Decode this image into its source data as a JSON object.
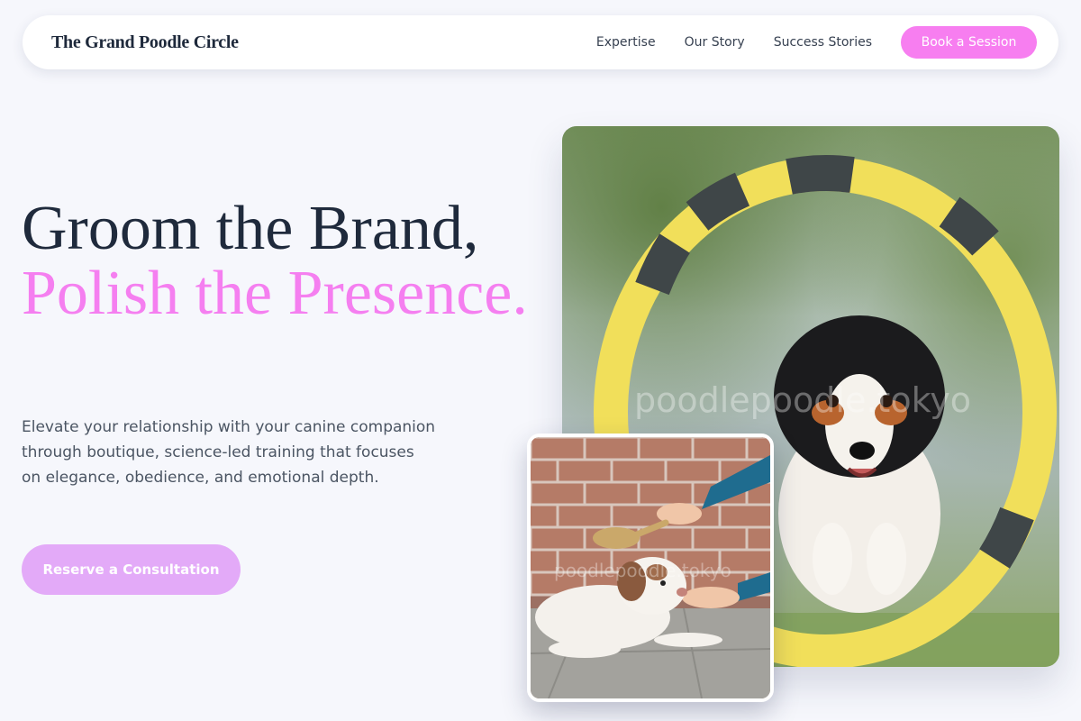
{
  "nav": {
    "brand": "The Grand Poodle Circle",
    "links": [
      "Expertise",
      "Our Story",
      "Success Stories"
    ],
    "cta": "Book a Session"
  },
  "hero": {
    "headline_line1": "Groom the Brand,",
    "headline_line2": "Polish the Presence.",
    "description": "Elevate your relationship with your canine companion through boutique, science-led training that focuses on elegance, obedience, and emotional depth.",
    "cta": "Reserve a Consultation"
  },
  "images": {
    "main_watermark": "poodlepoodle.tokyo",
    "small_watermark": "poodlepoodle.tokyo"
  },
  "colors": {
    "accent": "#f77ef0",
    "cta_soft": "#e3aaf8",
    "headline_dark": "#1f2a3c",
    "background": "#f6f7fc"
  }
}
